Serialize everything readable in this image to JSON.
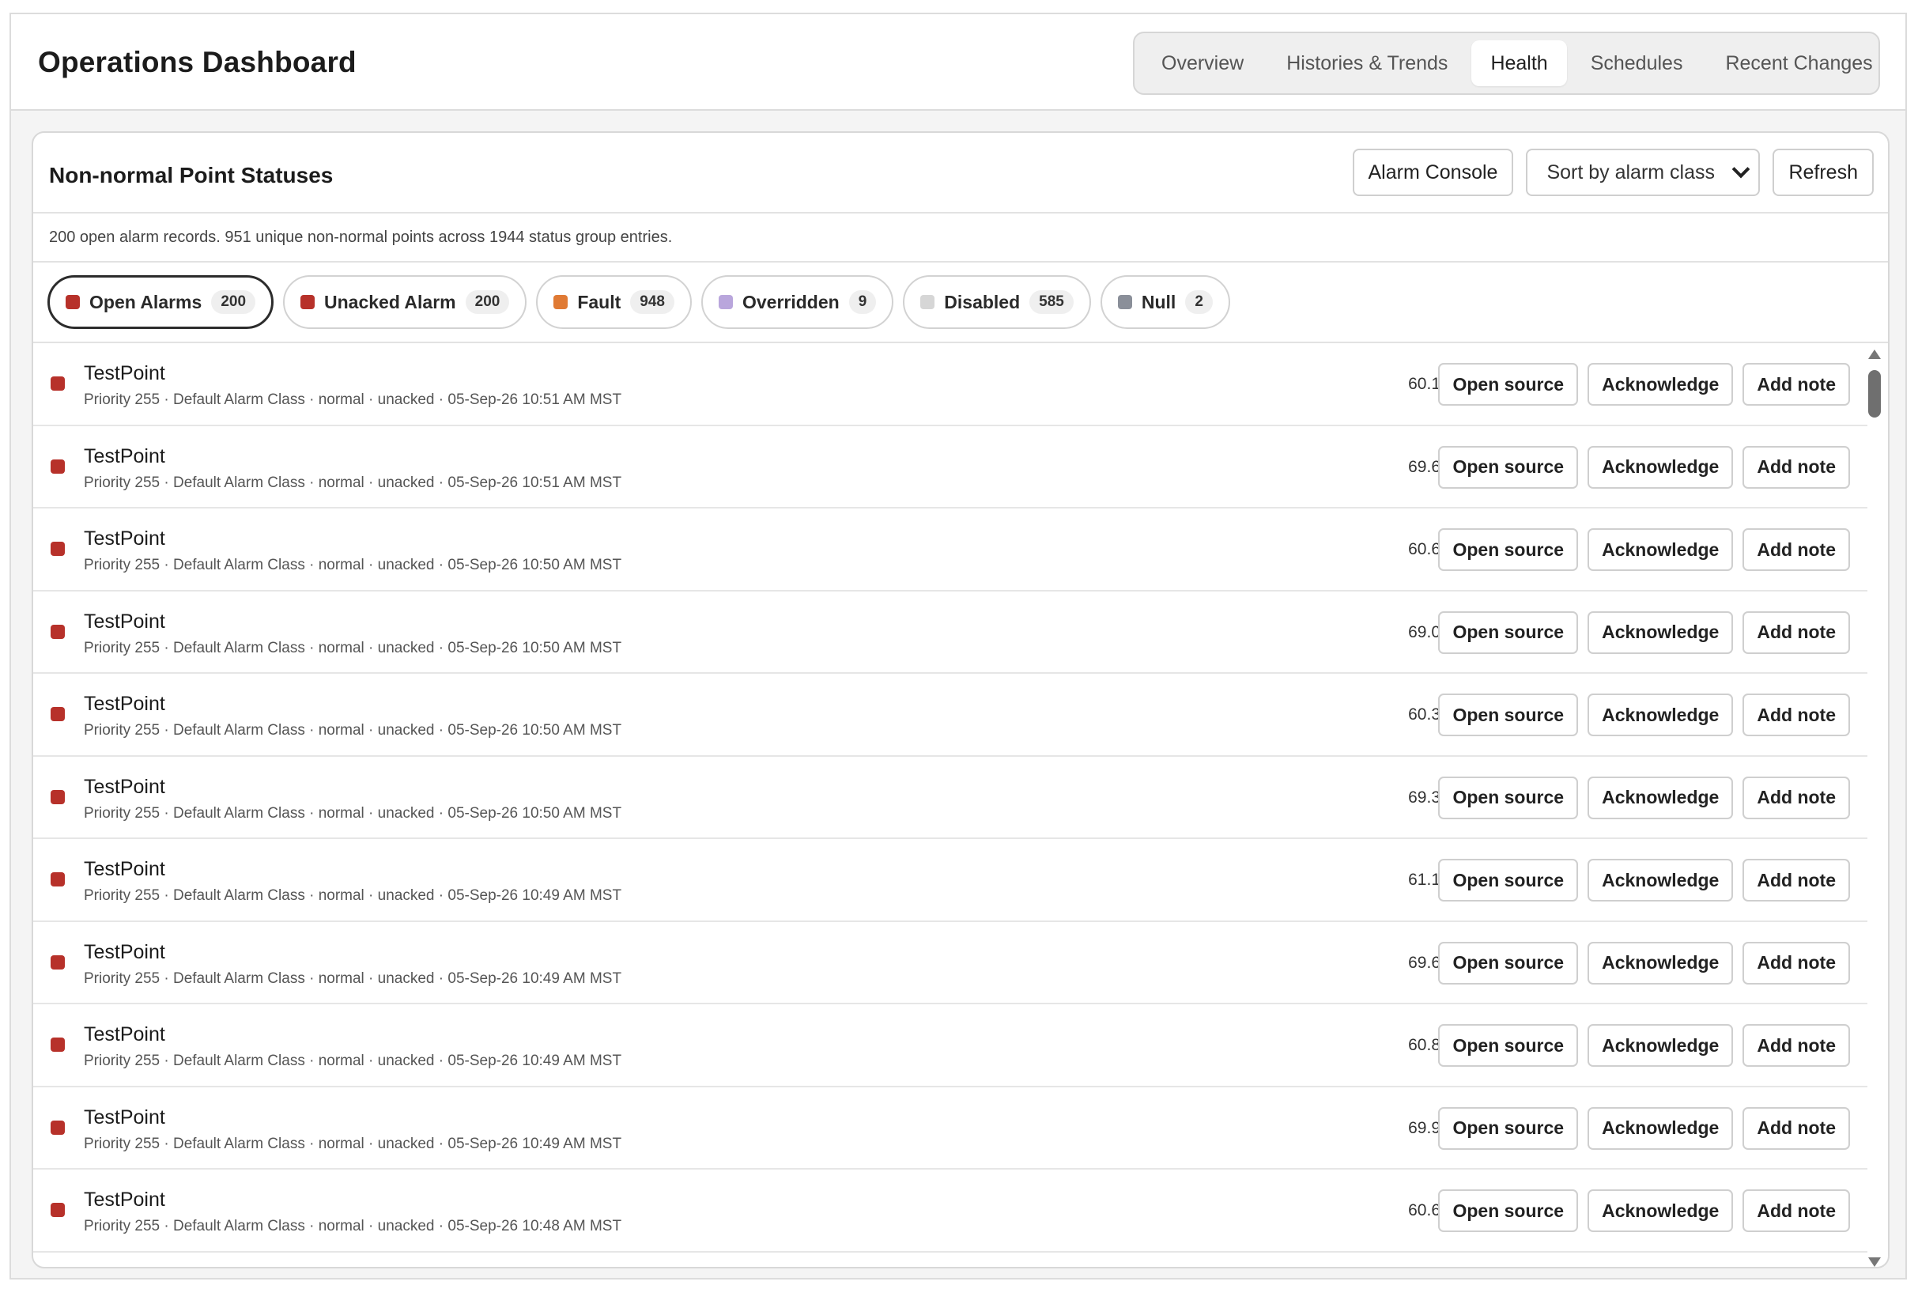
{
  "header": {
    "title": "Operations Dashboard",
    "tabs": [
      {
        "label": "Overview"
      },
      {
        "label": "Histories & Trends"
      },
      {
        "label": "Health"
      },
      {
        "label": "Schedules"
      },
      {
        "label": "Recent Changes"
      }
    ],
    "active_tab": "Health"
  },
  "panel": {
    "title": "Non-normal Point Statuses",
    "alarm_console_label": "Alarm Console",
    "sort_select_value": "Sort by alarm class",
    "refresh_label": "Refresh",
    "summary": "200 open alarm records. 951 unique non-normal points across 1944 status group entries."
  },
  "filters": [
    {
      "label": "Open Alarms",
      "count": "200",
      "color": "#b7312a",
      "selected": true
    },
    {
      "label": "Unacked Alarm",
      "count": "200",
      "color": "#b7312a",
      "selected": false
    },
    {
      "label": "Fault",
      "count": "948",
      "color": "#e07a34",
      "selected": false
    },
    {
      "label": "Overridden",
      "count": "9",
      "color": "#b9a6dc",
      "selected": false
    },
    {
      "label": "Disabled",
      "count": "585",
      "color": "#d6d6d6",
      "selected": false
    },
    {
      "label": "Null",
      "count": "2",
      "color": "#8a8f99",
      "selected": false
    }
  ],
  "row_actions": {
    "open_source": "Open source",
    "acknowledge": "Acknowledge",
    "add_note": "Add note"
  },
  "rows": [
    {
      "name": "TestPoint",
      "meta": "Priority 255 · Default Alarm Class · normal · unacked · 05-Sep-26 10:51 AM MST",
      "value": "60.1"
    },
    {
      "name": "TestPoint",
      "meta": "Priority 255 · Default Alarm Class · normal · unacked · 05-Sep-26 10:51 AM MST",
      "value": "69.6"
    },
    {
      "name": "TestPoint",
      "meta": "Priority 255 · Default Alarm Class · normal · unacked · 05-Sep-26 10:50 AM MST",
      "value": "60.6"
    },
    {
      "name": "TestPoint",
      "meta": "Priority 255 · Default Alarm Class · normal · unacked · 05-Sep-26 10:50 AM MST",
      "value": "69.0"
    },
    {
      "name": "TestPoint",
      "meta": "Priority 255 · Default Alarm Class · normal · unacked · 05-Sep-26 10:50 AM MST",
      "value": "60.3"
    },
    {
      "name": "TestPoint",
      "meta": "Priority 255 · Default Alarm Class · normal · unacked · 05-Sep-26 10:50 AM MST",
      "value": "69.3"
    },
    {
      "name": "TestPoint",
      "meta": "Priority 255 · Default Alarm Class · normal · unacked · 05-Sep-26 10:49 AM MST",
      "value": "61.1"
    },
    {
      "name": "TestPoint",
      "meta": "Priority 255 · Default Alarm Class · normal · unacked · 05-Sep-26 10:49 AM MST",
      "value": "69.6"
    },
    {
      "name": "TestPoint",
      "meta": "Priority 255 · Default Alarm Class · normal · unacked · 05-Sep-26 10:49 AM MST",
      "value": "60.8"
    },
    {
      "name": "TestPoint",
      "meta": "Priority 255 · Default Alarm Class · normal · unacked · 05-Sep-26 10:49 AM MST",
      "value": "69.9"
    },
    {
      "name": "TestPoint",
      "meta": "Priority 255 · Default Alarm Class · normal · unacked · 05-Sep-26 10:48 AM MST",
      "value": "60.6"
    }
  ],
  "row_status_color": "#b7312a"
}
